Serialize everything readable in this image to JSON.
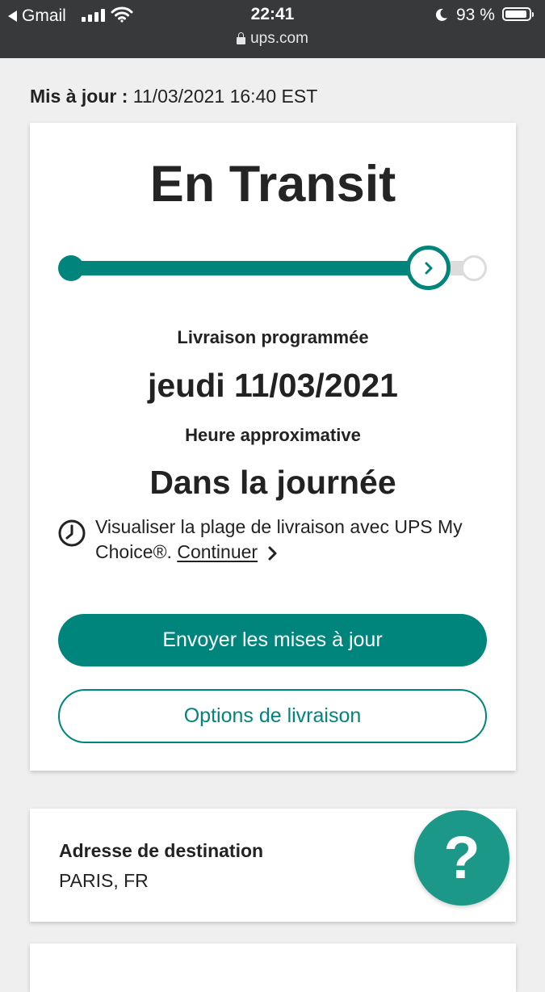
{
  "status_bar": {
    "back_app": "Gmail",
    "time": "22:41",
    "url": "ups.com",
    "battery": "93 %",
    "battery_level": 0.93,
    "icons": [
      "back-arrow-icon",
      "signal-icon",
      "wifi-icon",
      "lock-icon",
      "moon-icon",
      "battery-icon"
    ]
  },
  "updated": {
    "label": "Mis à jour :",
    "value": "11/03/2021 16:40 EST"
  },
  "tracking": {
    "status": "En Transit",
    "progress_steps": 3,
    "current_step": 2,
    "scheduled_label": "Livraison programmée",
    "scheduled_date": "jeudi 11/03/2021",
    "time_label": "Heure approximative",
    "time_window": "Dans la journée",
    "my_choice_text": "Visualiser la plage de livraison avec UPS My Choice®.",
    "my_choice_link": "Continuer",
    "send_updates_button": "Envoyer les mises à jour",
    "delivery_options_button": "Options de livraison"
  },
  "destination": {
    "label": "Adresse de destination",
    "value": "PARIS, FR"
  },
  "help_button": "?",
  "colors": {
    "accent": "#00857c",
    "help": "#1c9888",
    "status_bar_bg": "#37393b",
    "page_bg": "#efefef"
  }
}
